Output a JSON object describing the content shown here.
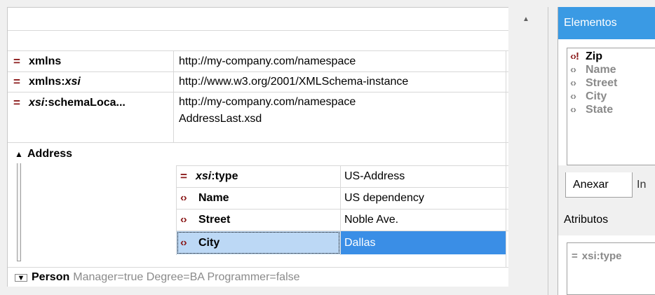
{
  "grid": {
    "attributes": [
      {
        "prefix": "",
        "name": "xmlns",
        "value": "http://my-company.com/namespace"
      },
      {
        "prefix": "xmlns:",
        "name": "xsi",
        "value": "http://www.w3.org/2001/XMLSchema-instance"
      },
      {
        "prefix": "xsi",
        "name": ":schemaLoca...",
        "value_line1": "http://my-company.com/namespace",
        "value_line2": "AddressLast.xsd"
      }
    ],
    "address": {
      "label": "Address",
      "expand_icon": "triangle-up-icon",
      "rows": [
        {
          "kind": "attribute",
          "prefix": "xsi",
          "name": ":type",
          "value": "US-Address"
        },
        {
          "kind": "element",
          "name": "Name",
          "value": "US dependency"
        },
        {
          "kind": "element",
          "name": "Street",
          "value": "Noble Ave."
        },
        {
          "kind": "element",
          "name": "City",
          "value": "Dallas",
          "selected": true
        }
      ]
    },
    "person": {
      "label": "Person",
      "summary": "Manager=true Degree=BA Programmer=false",
      "expand_icon": "triangle-down-icon"
    }
  },
  "sidebar": {
    "elements_title": "Elementos",
    "elements": [
      {
        "name": "Zip",
        "mandatory": true
      },
      {
        "name": "Name",
        "mandatory": false
      },
      {
        "name": "Street",
        "mandatory": false
      },
      {
        "name": "City",
        "mandatory": false
      },
      {
        "name": "State",
        "mandatory": false
      }
    ],
    "tabs": [
      "Anexar",
      "In"
    ],
    "attributes_title": "Atributos",
    "attributes": [
      "xsi:type"
    ]
  },
  "colors": {
    "selection": "#3a8ee6",
    "panel_header": "#3a9ae4",
    "icon": "#8b1a1a"
  }
}
